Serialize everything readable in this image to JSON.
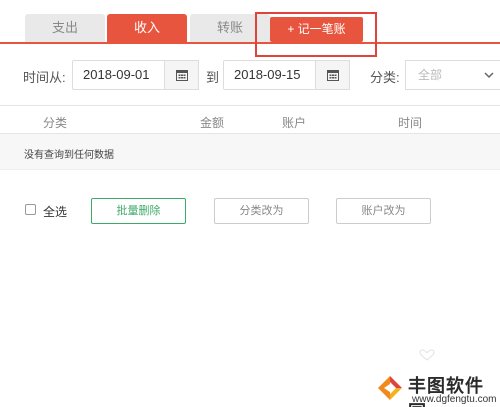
{
  "tabs": [
    {
      "label": "支出"
    },
    {
      "label": "收入"
    },
    {
      "label": "转账"
    }
  ],
  "add_button": {
    "label": "+ 记一笔账"
  },
  "filter": {
    "from_label": "时间从:",
    "from_date": "2018-09-01",
    "to_label": "到",
    "to_date": "2018-09-15",
    "category_label": "分类:",
    "category_value": "全部"
  },
  "table": {
    "columns": [
      "分类",
      "金额",
      "账户",
      "时间"
    ],
    "empty_text": "没有查询到任何数据"
  },
  "actions": {
    "select_all": "全选",
    "batch_delete": "批量删除",
    "change_category": "分类改为",
    "change_account": "账户改为"
  },
  "watermark": {
    "title": "丰图软件园",
    "url": "www.dgfengtu.com"
  },
  "colors": {
    "accent": "#e8553e",
    "highlight": "#e0433a",
    "green": "#3daa6a"
  }
}
